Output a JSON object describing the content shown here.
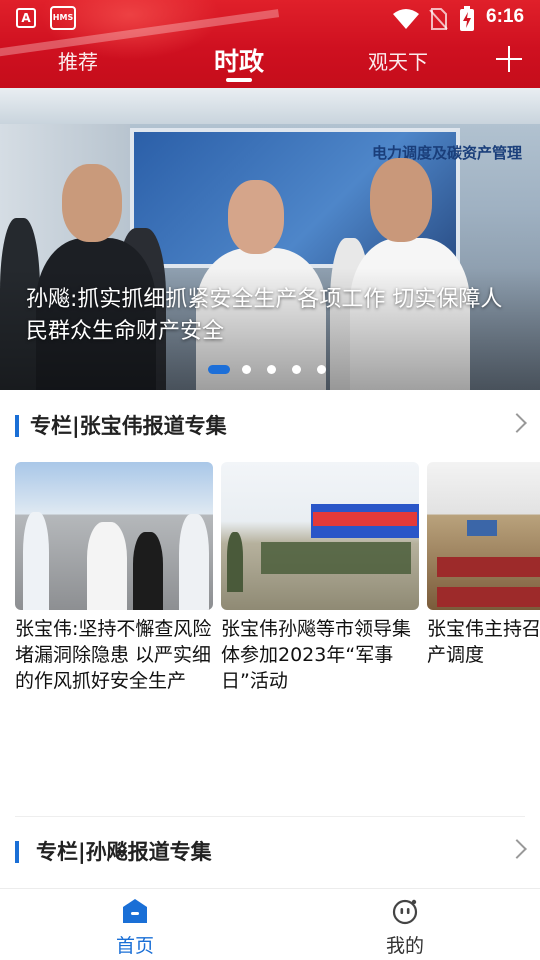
{
  "status_bar": {
    "time": "6:16",
    "app_icon_1": "A",
    "app_icon_2": "HMS"
  },
  "top_tabs": [
    {
      "label": "推荐",
      "active": false
    },
    {
      "label": "时政",
      "active": true
    },
    {
      "label": "观天下",
      "active": false
    }
  ],
  "banner": {
    "caption": "孙飚:抓实抓细抓紧安全生产各项工作 切实保障人民群众生命财产安全",
    "sign_text": "电力调度及碳资产管理",
    "slide_count": 5,
    "active_slide": 1
  },
  "section1": {
    "title": "专栏|张宝伟报道专集",
    "cards": [
      {
        "text": "张宝伟:坚持不懈查风险堵漏洞除隐患 以严实细的作风抓好安全生产"
      },
      {
        "text": "张宝伟孙飚等市领导集体参加2023年“军事日”活动"
      },
      {
        "text": "张宝伟主持召开安全生产调度"
      }
    ]
  },
  "section2": {
    "title": "专栏|孙飚报道专集"
  },
  "bottom_nav": {
    "home_label": "首页",
    "mine_label": "我的"
  },
  "colors": {
    "header_red": "#d01522",
    "accent_blue": "#1a6fd6"
  },
  "icons": {
    "plus": "add-channel-icon",
    "chevron": "chevron-right-icon",
    "home": "home-icon",
    "mine": "profile-face-icon"
  }
}
